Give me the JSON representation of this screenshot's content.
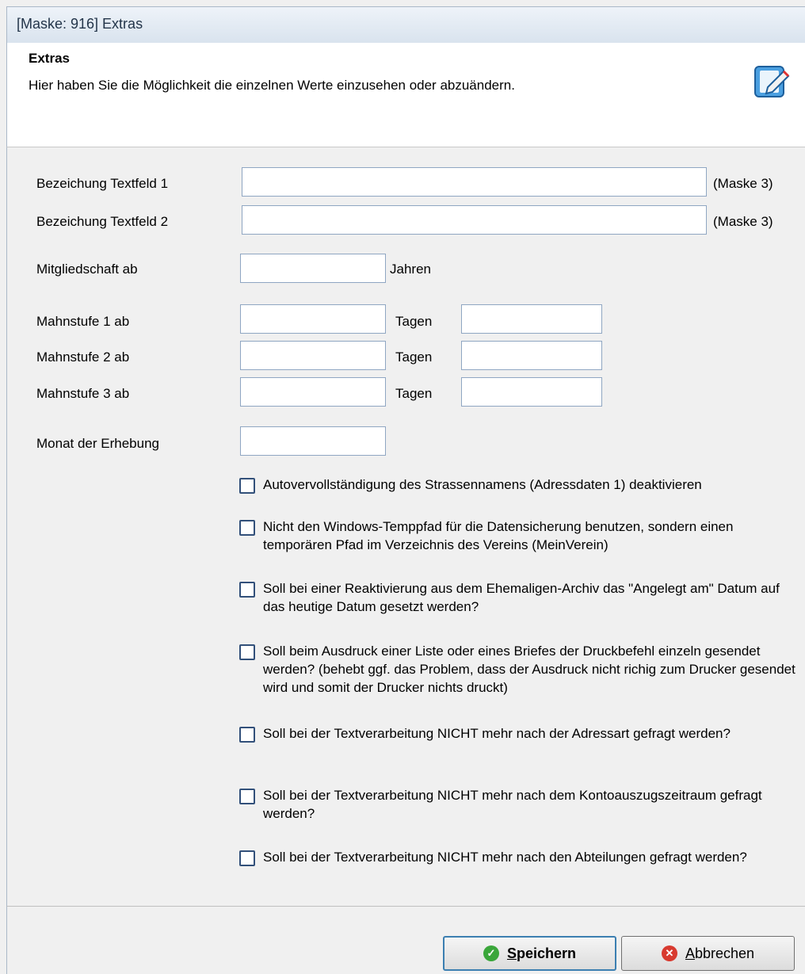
{
  "window": {
    "title": "[Maske: 916] Extras"
  },
  "header": {
    "title": "Extras",
    "subtitle": "Hier haben Sie die Möglichkeit die einzelnen Werte einzusehen oder abzuändern.",
    "icon": "edit-document-icon"
  },
  "form": {
    "textfeld1": {
      "label": "Bezeichung Textfeld 1",
      "value": "",
      "suffix": "(Maske 3)"
    },
    "textfeld2": {
      "label": "Bezeichung Textfeld 2",
      "value": "",
      "suffix": "(Maske 3)"
    },
    "mitglied": {
      "label": "Mitgliedschaft ab",
      "value": "",
      "unit": "Jahren"
    },
    "mahn1": {
      "label": "Mahnstufe 1 ab",
      "value": "",
      "unit": "Tagen",
      "value2": ""
    },
    "mahn2": {
      "label": "Mahnstufe 2 ab",
      "value": "",
      "unit": "Tagen",
      "value2": ""
    },
    "mahn3": {
      "label": "Mahnstufe 3 ab",
      "value": "",
      "unit": "Tagen",
      "value2": ""
    },
    "monat": {
      "label": "Monat der Erhebung",
      "value": ""
    }
  },
  "checkboxes": [
    {
      "text": "Autovervollständigung des Strassennamens (Adressdaten 1) deaktivieren",
      "checked": false
    },
    {
      "text": "Nicht den Windows-Temppfad für die Datensicherung benutzen, sondern einen temporären Pfad im Verzeichnis des Vereins (MeinVerein)",
      "checked": false
    },
    {
      "text": "Soll bei einer Reaktivierung aus dem Ehemaligen-Archiv das \"Angelegt am\" Datum auf das heutige Datum gesetzt werden?",
      "checked": false
    },
    {
      "text": "Soll beim Ausdruck einer Liste oder eines Briefes der Druckbefehl einzeln gesendet werden? (behebt ggf. das Problem, dass der Ausdruck nicht richig zum Drucker gesendet wird und somit der Drucker nichts druckt)",
      "checked": false
    },
    {
      "text": "Soll bei der Textverarbeitung NICHT mehr nach der Adressart gefragt werden?",
      "checked": false
    },
    {
      "text": "Soll bei der Textverarbeitung NICHT mehr nach dem Kontoauszugszeitraum gefragt werden?",
      "checked": false
    },
    {
      "text": "Soll bei der Textverarbeitung NICHT mehr nach den Abteilungen gefragt werden?",
      "checked": false
    }
  ],
  "footer": {
    "save_label": "Speichern",
    "cancel_label": "Abbrechen"
  }
}
